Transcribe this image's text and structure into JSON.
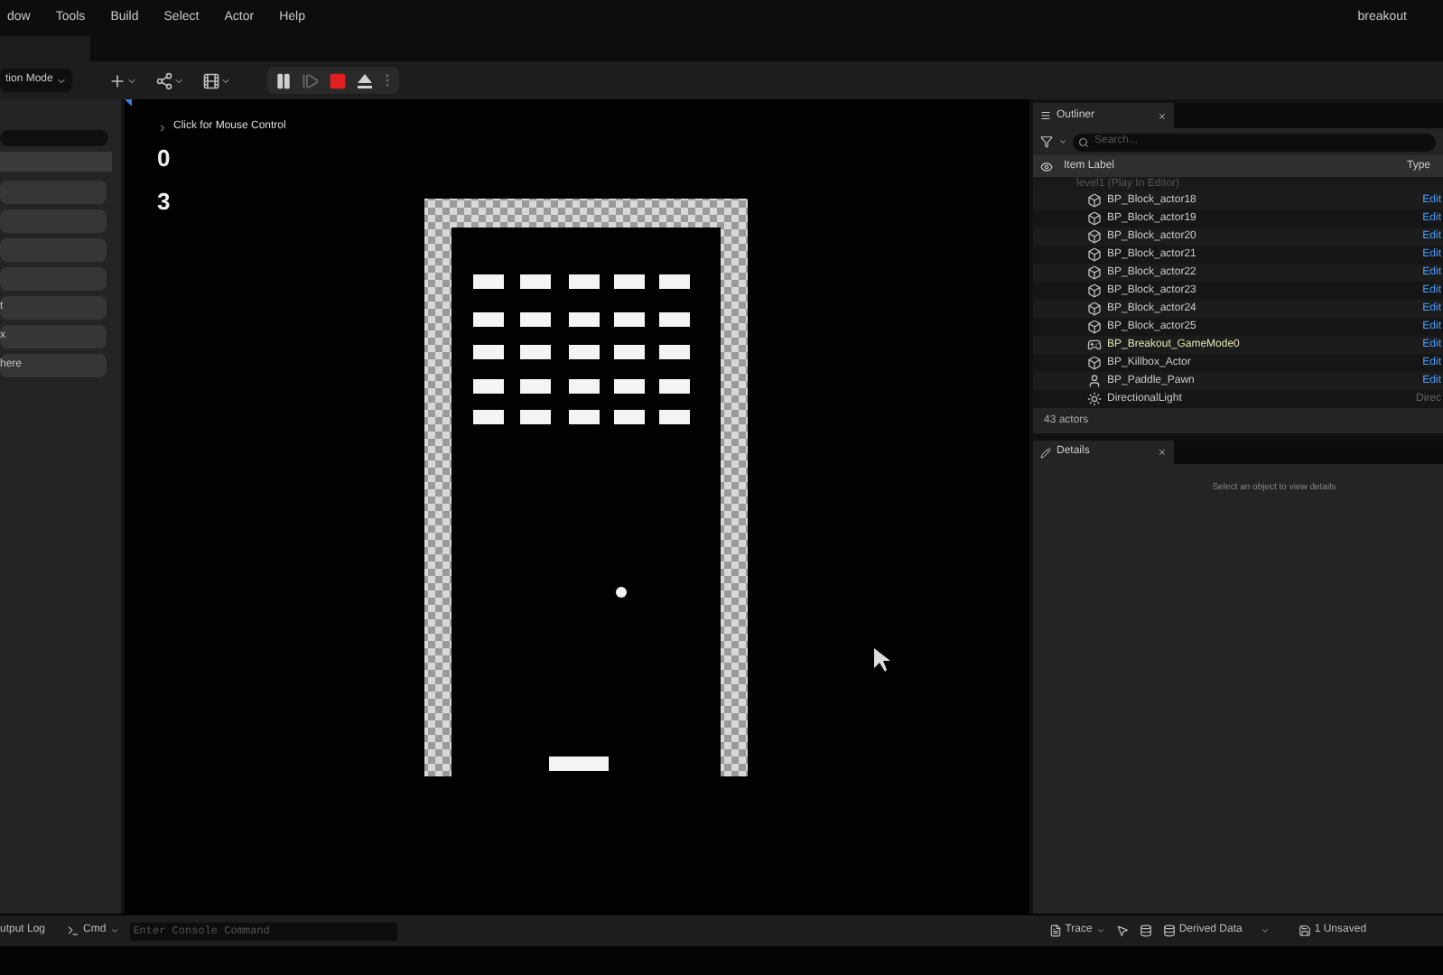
{
  "menu": [
    "dow",
    "Tools",
    "Build",
    "Select",
    "Actor",
    "Help"
  ],
  "project": "breakout",
  "toolbar": {
    "mode": "tion Mode",
    "controls": [
      {
        "kind": "pause",
        "disabled": false
      },
      {
        "kind": "step",
        "disabled": true
      },
      {
        "kind": "stop",
        "disabled": false
      },
      {
        "kind": "eject",
        "disabled": false
      }
    ]
  },
  "left_panel": {
    "rows": [
      "t",
      "x",
      "here"
    ]
  },
  "viewport": {
    "hint": "Click for Mouse Control",
    "score": "0",
    "lives": "3"
  },
  "outliner": {
    "tab": "Outliner",
    "search": {
      "placeholder": "Search..."
    },
    "columns": [
      "Item Label",
      "Type"
    ],
    "group": "level1 (Play In Editor)",
    "rows": [
      {
        "label": "BP_Block_actor18",
        "kind": "actor",
        "type": "Edit",
        "link": true
      },
      {
        "label": "BP_Block_actor19",
        "kind": "actor",
        "type": "Edit",
        "link": true
      },
      {
        "label": "BP_Block_actor20",
        "kind": "actor",
        "type": "Edit",
        "link": true
      },
      {
        "label": "BP_Block_actor21",
        "kind": "actor",
        "type": "Edit",
        "link": true
      },
      {
        "label": "BP_Block_actor22",
        "kind": "actor",
        "type": "Edit",
        "link": true
      },
      {
        "label": "BP_Block_actor23",
        "kind": "actor",
        "type": "Edit",
        "link": true
      },
      {
        "label": "BP_Block_actor24",
        "kind": "actor",
        "type": "Edit",
        "link": true
      },
      {
        "label": "BP_Block_actor25",
        "kind": "actor",
        "type": "Edit",
        "link": true
      },
      {
        "label": "BP_Breakout_GameMode0",
        "kind": "gamemode",
        "type": "Edit",
        "link": true
      },
      {
        "label": "BP_Killbox_Actor",
        "kind": "actor",
        "type": "Edit",
        "link": true
      },
      {
        "label": "BP_Paddle_Pawn",
        "kind": "pawn",
        "type": "Edit",
        "link": true
      },
      {
        "label": "DirectionalLight",
        "kind": "light",
        "type": "Direc",
        "link": false
      }
    ],
    "count": "43 actors"
  },
  "details": {
    "tab": "Details",
    "empty": "Select an object to view details"
  },
  "status_bar": {
    "output": "utput Log",
    "cmd": "Cmd",
    "console": {
      "placeholder": "Enter Console Command"
    },
    "trace": "Trace",
    "derived": "Derived Data",
    "unsaved": "1 Unsaved"
  }
}
